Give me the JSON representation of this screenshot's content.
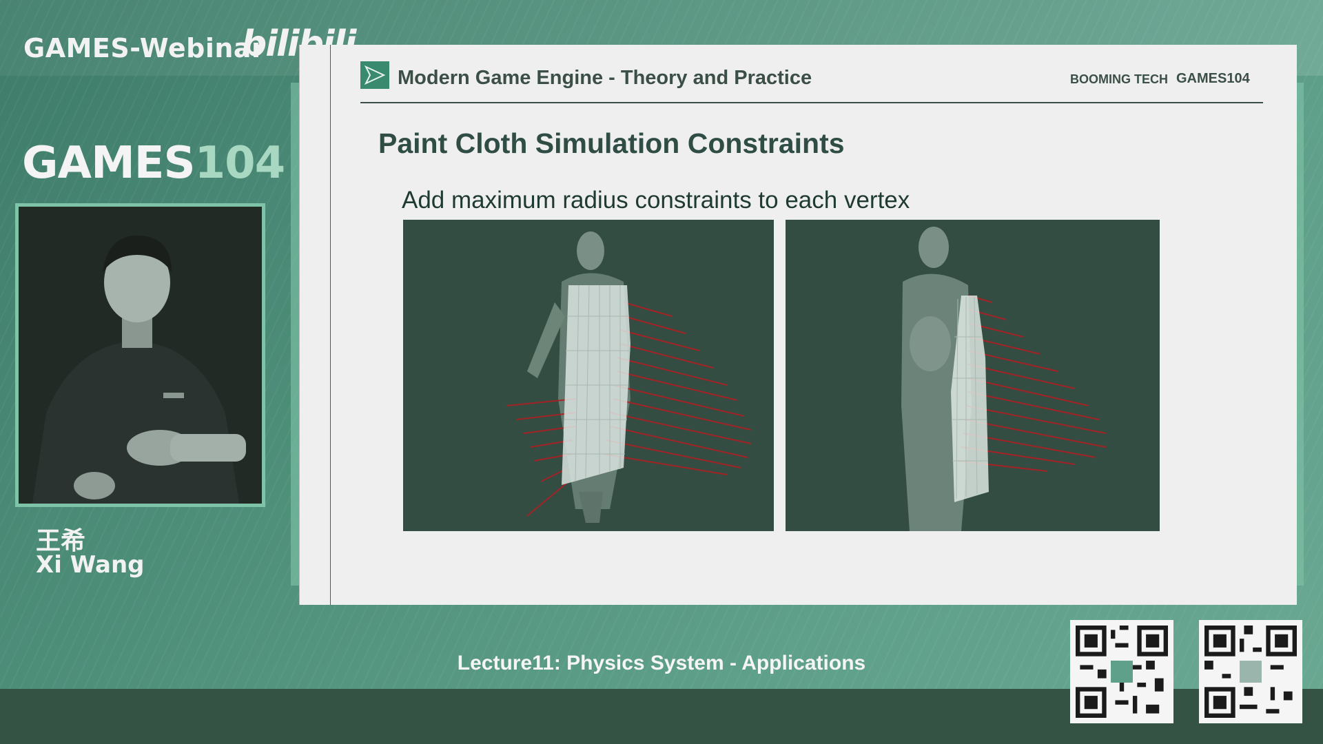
{
  "header": {
    "webinar_title": "GAMES-Webinar",
    "bilibili_logo": "bilibili",
    "games_logo_text": "GAMES",
    "games_logo_num": "104"
  },
  "speaker": {
    "name_cn": "王希",
    "name_en": "Xi Wang"
  },
  "slide": {
    "course_title": "Modern Game Engine - Theory and Practice",
    "brand_booming": "BOOMING TECH",
    "brand_games": "GAMES104",
    "title": "Paint Cloth Simulation Constraints",
    "subtitle": "Add maximum radius constraints to each vertex"
  },
  "footer": {
    "lecture": "Lecture11: Physics System - Applications"
  },
  "colors": {
    "background": "#4d8e79",
    "accent": "#7fc4a8",
    "slide_bg": "#efefef",
    "panel_bg": "#344d43",
    "constraint_red": "#b01e22"
  },
  "icons": [
    "slide-logo-icon",
    "qr-code-left",
    "qr-code-right"
  ]
}
